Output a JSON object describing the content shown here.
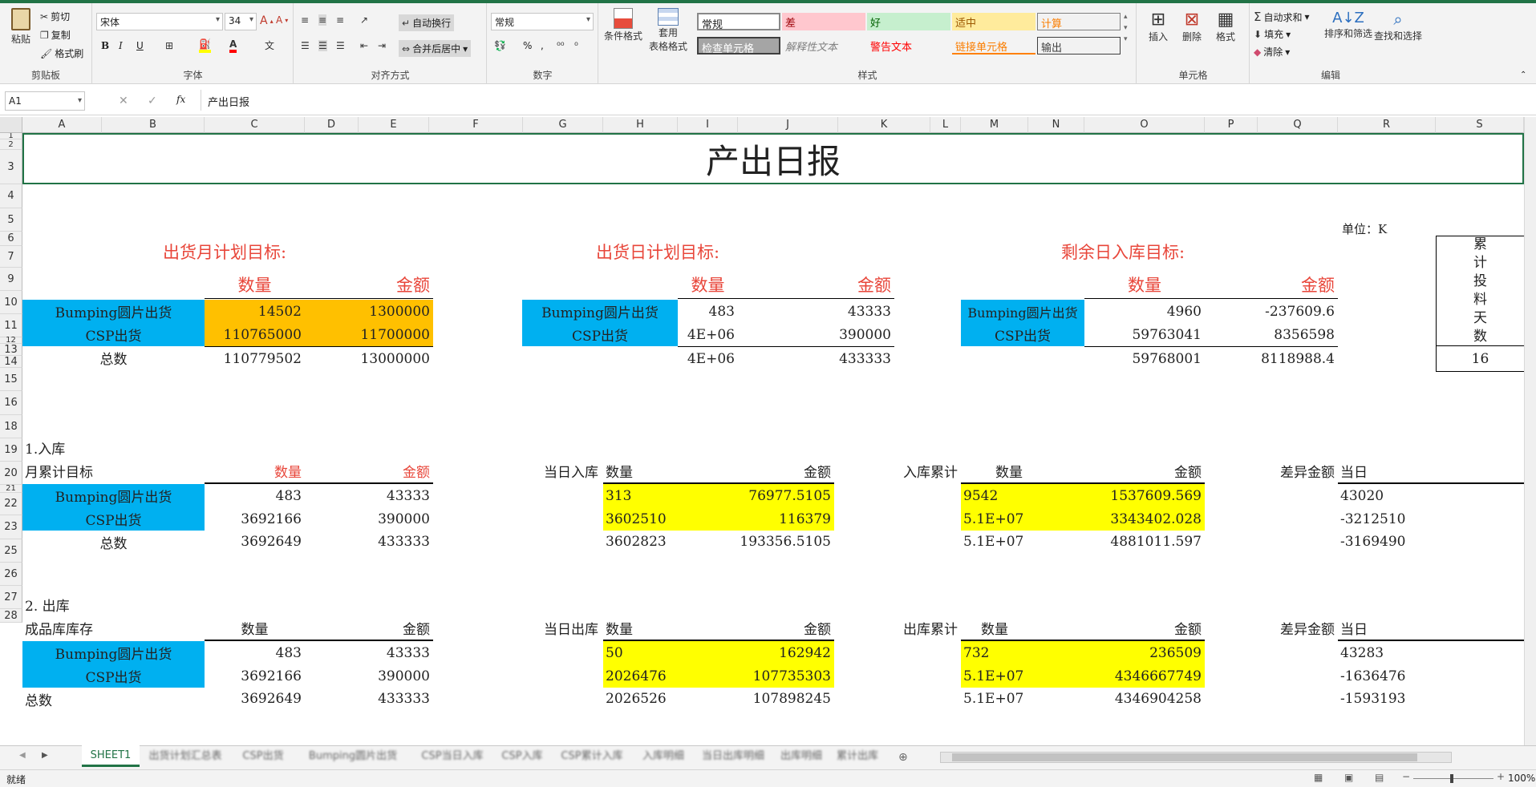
{
  "ribbon": {
    "clipboard": {
      "paste": "粘贴",
      "cut": "剪切",
      "copy": "复制",
      "format_painter": "格式刷",
      "label": "剪贴板"
    },
    "font": {
      "name": "宋体",
      "size": "34",
      "bold": "B",
      "italic": "I",
      "underline": "U",
      "label": "字体"
    },
    "alignment": {
      "wrap": "自动换行",
      "merge": "合并后居中",
      "label": "对齐方式"
    },
    "number": {
      "format": "常规",
      "percent": "%",
      "comma": ",",
      "label": "数字"
    },
    "styles": {
      "cond_format": "条件格式",
      "table_format_1": "套用",
      "table_format_2": "表格格式",
      "cells": [
        "常规",
        "差",
        "好",
        "适中",
        "计算",
        "检查单元格",
        "解释性文本",
        "警告文本",
        "链接单元格",
        "输出"
      ],
      "label": "样式"
    },
    "cells_group": {
      "insert": "插入",
      "delete": "删除",
      "format": "格式",
      "label": "单元格"
    },
    "editing": {
      "autosum": "自动求和",
      "fill": "填充",
      "clear": "清除",
      "sort": "排序和筛选",
      "find": "查找和选择",
      "label": "编辑"
    }
  },
  "formula_bar": {
    "name_box": "A1",
    "fx": "fx",
    "content": "产出日报"
  },
  "columns": [
    "A",
    "B",
    "C",
    "D",
    "E",
    "F",
    "G",
    "H",
    "I",
    "J",
    "K",
    "L",
    "M",
    "N",
    "O",
    "P",
    "Q",
    "R",
    "S"
  ],
  "rows": [
    "1",
    "2",
    "3",
    "4",
    "5",
    "6",
    "7",
    "8",
    "9",
    "10",
    "11",
    "12",
    "13",
    "14",
    "15",
    "16",
    "17",
    "18",
    "19",
    "20",
    "21",
    "22",
    "23",
    "24",
    "25",
    "26",
    "27",
    "28"
  ],
  "sheet": {
    "title": "产出日报",
    "unit": "单位：K",
    "sec1": {
      "h1": "出货月计划目标:",
      "h2": "出货日计划目标:",
      "h3": "剩余日入库目标:",
      "qty": "数量",
      "amt": "金额",
      "bumping": "Bumping圆片出货",
      "csp": "CSP出货",
      "total": "总数",
      "m_b_q": "14502",
      "m_b_a": "1300000",
      "m_c_q": "110765000",
      "m_c_a": "11700000",
      "m_t_q": "110779502",
      "m_t_a": "13000000",
      "d_b_q": "483",
      "d_b_a": "43333",
      "d_c_q": "4E+06",
      "d_c_a": "390000",
      "d_t_q": "4E+06",
      "d_t_a": "433333",
      "r_b_q": "4960",
      "r_b_a": "-237609.6",
      "r_c_q": "59763041",
      "r_c_a": "8356598",
      "r_t_q": "59768001",
      "r_t_a": "8118988.4",
      "days_label": [
        "累",
        "计",
        "投",
        "料",
        "天",
        "数"
      ],
      "days_value": "16"
    },
    "sec2": {
      "title": "1.入库",
      "month_target": "月累计目标",
      "qty": "数量",
      "amt": "金额",
      "day_label": "当日入库",
      "cum_label": "入库累计",
      "diff_label": "差异金额",
      "today": "当日",
      "bumping": "Bumping圆片出货",
      "csp": "CSP出货",
      "total": "总数",
      "m": [
        [
          "483",
          "43333"
        ],
        [
          "3692166",
          "390000"
        ],
        [
          "3692649",
          "433333"
        ]
      ],
      "d": [
        [
          "313",
          "76977.5105"
        ],
        [
          "3602510",
          "116379"
        ],
        [
          "3602823",
          "193356.5105"
        ]
      ],
      "c": [
        [
          "9542",
          "1537609.569"
        ],
        [
          "5.1E+07",
          "3343402.028"
        ],
        [
          "5.1E+07",
          "4881011.597"
        ]
      ],
      "t": [
        "43020",
        "-3212510",
        "-3169490"
      ]
    },
    "sec3": {
      "title": "2. 出库",
      "stock": "成品库库存",
      "qty": "数量",
      "amt": "金额",
      "day_label": "当日出库",
      "cum_label": "出库累计",
      "diff_label": "差异金额",
      "today": "当日",
      "bumping": "Bumping圆片出货",
      "csp": "CSP出货",
      "total": "总数",
      "m": [
        [
          "483",
          "43333"
        ],
        [
          "3692166",
          "390000"
        ],
        [
          "3692649",
          "433333"
        ]
      ],
      "d": [
        [
          "50",
          "162942"
        ],
        [
          "2026476",
          "107735303"
        ],
        [
          "2026526",
          "107898245"
        ]
      ],
      "c": [
        [
          "732",
          "236509"
        ],
        [
          "5.1E+07",
          "4346667749"
        ],
        [
          "5.1E+07",
          "4346904258"
        ]
      ],
      "t": [
        "43283",
        "-1636476",
        "-1593193"
      ]
    }
  },
  "tabs": {
    "active": "SHEET1",
    "others": [
      "出货计划汇总表",
      "CSP出货",
      "Bumping圆片出货",
      "CSP当日入库",
      "CSP入库",
      "CSP累计入库",
      "入库明细",
      "当日出库明细",
      "出库明细",
      "累计出库"
    ]
  },
  "status": {
    "ready": "就绪",
    "zoom": "100%"
  }
}
